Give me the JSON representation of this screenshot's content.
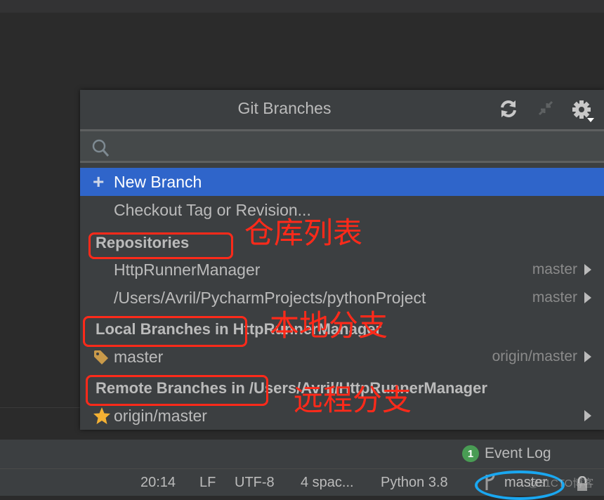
{
  "popup": {
    "title": "Git Branches",
    "header_icons": [
      "refresh-icon",
      "collapse-icon",
      "settings-icon"
    ],
    "search": {
      "placeholder": "",
      "value": ""
    },
    "actions": [
      {
        "label": "New Branch",
        "icon": "plus-icon",
        "selected": true
      },
      {
        "label": "Checkout Tag or Revision..."
      }
    ],
    "repositories": {
      "header": "Repositories",
      "items": [
        {
          "name": "HttpRunnerManager",
          "branch": "master"
        },
        {
          "name": "/Users/Avril/PycharmProjects/pythonProject",
          "branch": "master"
        }
      ]
    },
    "local_branches": {
      "header": "Local Branches",
      "suffix": "in HttpRunnerManager",
      "items": [
        {
          "name": "master",
          "tracking": "origin/master",
          "icon": "tag-icon"
        }
      ]
    },
    "remote_branches": {
      "header": "Remote Branches",
      "suffix": "in /Users/Avril/HttpRunnerManager",
      "items": [
        {
          "name": "origin/master",
          "icon": "star-icon"
        }
      ]
    }
  },
  "annotations": {
    "repositories": "仓库列表",
    "local": "本地分支",
    "remote": "远程分支"
  },
  "event_log": {
    "count": "1",
    "label": "Event Log"
  },
  "statusbar": {
    "position": "20:14",
    "line_separator": "LF",
    "encoding": "UTF-8",
    "indent": "4 spac...",
    "interpreter": "Python 3.8",
    "branch": "master"
  },
  "watermark": "@51CTO博客",
  "colors": {
    "selection": "#2f65ca",
    "annotation": "#ff2a1a",
    "highlight_ellipse": "#1aa7f0",
    "badge": "#499c54",
    "star": "#f4b133",
    "tag": "#c99a4a"
  }
}
